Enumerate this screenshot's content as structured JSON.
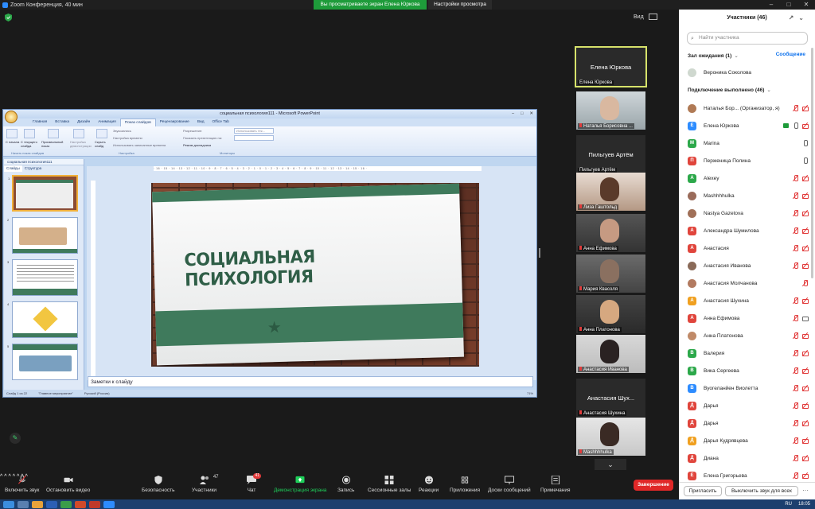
{
  "window": {
    "title": "Zoom Конференция, 40 мин",
    "share_banner": "Вы просматриваете экран Елена Юркова",
    "view_settings": "Настройки просмотра",
    "view_label": "Вид"
  },
  "ppt": {
    "title": "социальная психология111 - Microsoft PowerPoint",
    "tabs": [
      "Главная",
      "Вставка",
      "Дизайн",
      "Анимация",
      "Показ слайдов",
      "Рецензирование",
      "Вид",
      "Office Tab"
    ],
    "active_tab": "Показ слайдов",
    "ribbon": {
      "btn_from_start": "С начала",
      "btn_from_current": "С текущего слайда",
      "btn_custom": "Произвольный показ",
      "btn_setup": "Настройка демонстрации",
      "btn_hide": "Скрыть слайд",
      "chk_record": "Звукозапись",
      "chk_rehearse": "Настройка времени",
      "chk_timings": "Использовать записанные времена",
      "chk_resolution": "Разрешение:",
      "chk_show_on": "Показать презентацию на:",
      "chk_presenter": "Режим докладчика",
      "sel_resolution": "Использовать тек...",
      "grp_start": "Начать показ слайдов",
      "grp_setup": "Настройка",
      "grp_monitors": "Мониторы"
    },
    "file_tab": "социальная психология111",
    "left_tabs": [
      "Слайды",
      "Структура"
    ],
    "slide_numbers": [
      "1",
      "2",
      "3",
      "4",
      "5"
    ],
    "slide_title": "СОЦИАЛЬНАЯ ПСИХОЛОГИЯ",
    "ruler": "· 16 · 15 · 14 · 13 · 12 · 11 · 10 · 9 · 8 · 7 · 6 · 5 · 4 · 3 · 2 · 1 · 0 · 1 · 2 · 3 · 4 · 5 · 6 · 7 · 8 · 9 · 10 · 11 · 12 · 13 · 14 · 15 · 16 ·",
    "notes_placeholder": "Заметки к слайду",
    "status": {
      "slide_of": "Слайд 1 из 22",
      "theme": "\"Главное мероприятие\"",
      "language": "Русский (Россия)",
      "zoom": "71%"
    }
  },
  "gallery": [
    {
      "name": "Елена Юркова",
      "label": "Елена Юркова",
      "video": false,
      "active": true,
      "muted": false
    },
    {
      "name": "",
      "label": "Наталья Борисовна ...",
      "video": true,
      "active": false,
      "muted": true
    },
    {
      "name": "Пильгуев Артём",
      "label": "Пильгуев Артём",
      "video": false,
      "active": false,
      "muted": false
    },
    {
      "name": "",
      "label": "Лиза Гаштольд",
      "video": true,
      "active": false,
      "muted": true
    },
    {
      "name": "",
      "label": "Анна Ефимова",
      "video": true,
      "active": false,
      "muted": true
    },
    {
      "name": "",
      "label": "Мария Квасоля",
      "video": true,
      "active": false,
      "muted": true
    },
    {
      "name": "",
      "label": "Анна Платонова",
      "video": true,
      "active": false,
      "muted": true
    },
    {
      "name": "",
      "label": "Анастасия Иванова",
      "video": true,
      "active": false,
      "muted": true
    },
    {
      "name": "Анастасия  Шух...",
      "label": "Анастасия Шухина",
      "video": false,
      "active": false,
      "muted": true
    },
    {
      "name": "",
      "label": "Mashhhhulka",
      "video": true,
      "active": false,
      "muted": true
    }
  ],
  "panel": {
    "title": "Участники (46)",
    "search_placeholder": "Найти участника",
    "waiting_title": "Зал ожидания (1)",
    "message_link": "Сообщение",
    "waiting": [
      {
        "name": "Вероника Соколова"
      }
    ],
    "connected_title": "Подключение выполнено (46)",
    "participants": [
      {
        "initial": "",
        "name": "Наталья Бор... (Организатор, я)",
        "color": "#b07a55",
        "photo": true,
        "s1": "mic-off",
        "s2": "cam-off"
      },
      {
        "initial": "Е",
        "name": "Елена Юркова",
        "color": "#2d8cff",
        "photo": false,
        "s1": "share",
        "s2": "mic-on",
        "s3": "cam-off"
      },
      {
        "initial": "M",
        "name": "Marina",
        "color": "#2ca84a",
        "photo": false,
        "s1": "mic-on"
      },
      {
        "initial": "П",
        "name": "Перженица Полина",
        "color": "#e0453c",
        "photo": false,
        "s1": "mic-on"
      },
      {
        "initial": "A",
        "name": "Alexey",
        "color": "#2ca84a",
        "photo": false,
        "s1": "mic-off",
        "s2": "cam-off"
      },
      {
        "initial": "",
        "name": "Mashhhhulka",
        "color": "#9a6b5a",
        "photo": true,
        "s1": "mic-off",
        "s2": "cam-off"
      },
      {
        "initial": "",
        "name": "Nastya Gazetova",
        "color": "#a07058",
        "photo": true,
        "s1": "mic-off",
        "s2": "cam-off"
      },
      {
        "initial": "А",
        "name": "Александра Шумилова",
        "color": "#e0453c",
        "photo": false,
        "s1": "mic-off",
        "s2": "cam-off"
      },
      {
        "initial": "А",
        "name": "Анастасия",
        "color": "#e0453c",
        "photo": false,
        "s1": "mic-off",
        "s2": "cam-off"
      },
      {
        "initial": "",
        "name": "Анастасия Иванова",
        "color": "#8a6a58",
        "photo": true,
        "s1": "mic-off",
        "s2": "cam-off"
      },
      {
        "initial": "",
        "name": "Анастасия Молчанова",
        "color": "#b27a60",
        "photo": true,
        "s1": "mic-off"
      },
      {
        "initial": "А",
        "name": "Анастасия Шухина",
        "color": "#f0a020",
        "photo": false,
        "s1": "mic-off",
        "s2": "cam-off"
      },
      {
        "initial": "А",
        "name": "Анна Ефимова",
        "color": "#e0453c",
        "photo": false,
        "s1": "mic-off",
        "s2": "cam-on"
      },
      {
        "initial": "",
        "name": "Анна Платонова",
        "color": "#c08a68",
        "photo": true,
        "s1": "mic-off",
        "s2": "cam-off"
      },
      {
        "initial": "В",
        "name": "Валерия",
        "color": "#2ca84a",
        "photo": false,
        "s1": "mic-off",
        "s2": "cam-off"
      },
      {
        "initial": "В",
        "name": "Вика Сергеева",
        "color": "#2ca84a",
        "photo": false,
        "s1": "mic-off",
        "s2": "cam-off"
      },
      {
        "initial": "В",
        "name": "Вуогеланйен Виолетта",
        "color": "#2d8cff",
        "photo": false,
        "s1": "mic-off",
        "s2": "cam-off"
      },
      {
        "initial": "Д",
        "name": "Дарья",
        "color": "#e0453c",
        "photo": false,
        "s1": "mic-off",
        "s2": "cam-off"
      },
      {
        "initial": "Д",
        "name": "Дарья",
        "color": "#e0453c",
        "photo": false,
        "s1": "mic-off",
        "s2": "cam-off"
      },
      {
        "initial": "Д",
        "name": "Дарья Кудрявцева",
        "color": "#f0a020",
        "photo": false,
        "s1": "mic-off",
        "s2": "cam-off"
      },
      {
        "initial": "Д",
        "name": "Диана",
        "color": "#e0453c",
        "photo": false,
        "s1": "mic-off",
        "s2": "cam-off"
      },
      {
        "initial": "Е",
        "name": "Елена Григорьева",
        "color": "#e0453c",
        "photo": false,
        "s1": "mic-off",
        "s2": "cam-off"
      }
    ],
    "invite_button": "Пригласить",
    "mute_all_button": "Выключить звук для всех"
  },
  "toolbar": {
    "unmute": "Включить звук",
    "stop_video": "Остановить видео",
    "security": "Безопасность",
    "participants": "Участники",
    "participants_count": "47",
    "chat": "Чат",
    "chat_badge": "41",
    "share": "Демонстрация экрана",
    "record": "Запись",
    "breakout": "Сессионные залы",
    "reactions": "Реакции",
    "apps": "Приложения",
    "whiteboard": "Доски сообщений",
    "notes": "Примечания",
    "end": "Завершение"
  },
  "taskbar": {
    "lang": "RU",
    "time": "18:05"
  },
  "colors": {
    "share_green": "#1e9b3a",
    "end_red": "#e02828",
    "zoom_blue": "#0e72ed",
    "active_tile": "#d6e26a",
    "slide_green": "#3f7a5c"
  }
}
